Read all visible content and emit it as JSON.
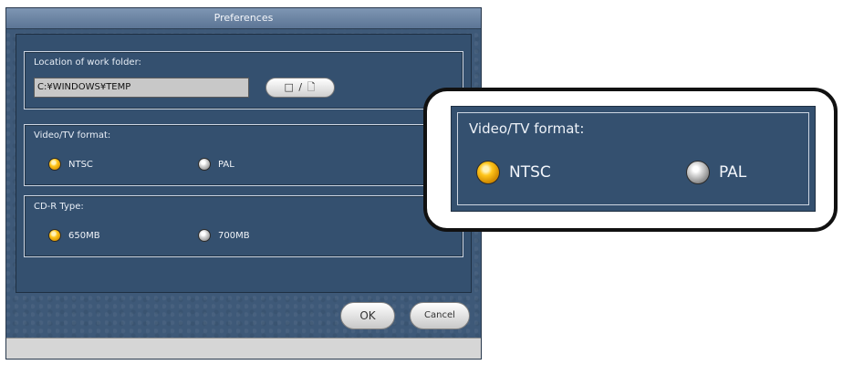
{
  "dialog": {
    "title": "Preferences",
    "work_folder": {
      "label": "Location of work folder:",
      "path": "C:¥WINDOWS¥TEMP",
      "browse_label": "□ / 🗋"
    },
    "video_format": {
      "label": "Video/TV format:",
      "options": [
        {
          "label": "NTSC",
          "selected": true
        },
        {
          "label": "PAL",
          "selected": false
        }
      ]
    },
    "cdr_type": {
      "label": "CD-R Type:",
      "options": [
        {
          "label": "650MB",
          "selected": true
        },
        {
          "label": "700MB",
          "selected": false
        }
      ]
    },
    "ok_label": "OK",
    "cancel_label": "Cancel"
  },
  "callout": {
    "label": "Video/TV format:",
    "options": [
      {
        "label": "NTSC",
        "selected": true
      },
      {
        "label": "PAL",
        "selected": false
      }
    ]
  },
  "colors": {
    "panel": "#34506f",
    "selected_radio": "#ffc51a",
    "unselected_radio": "#d6d6d6"
  }
}
